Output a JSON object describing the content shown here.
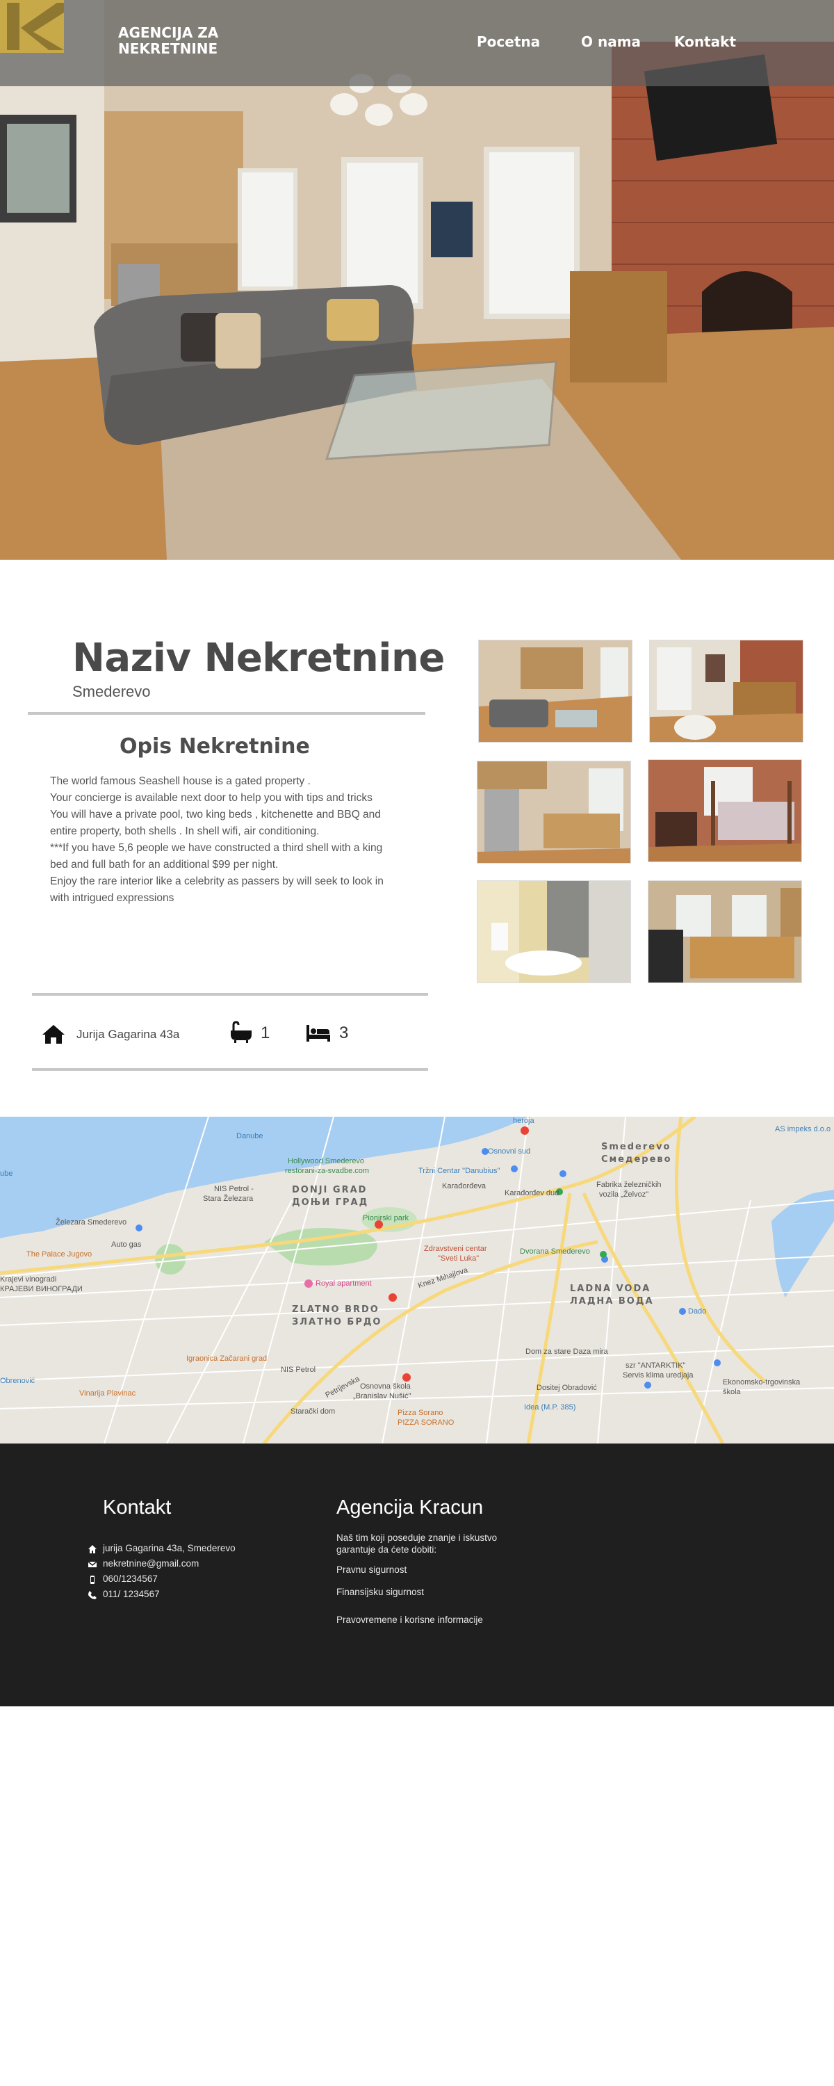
{
  "header": {
    "brand_line1": "AGENCIJA ZA",
    "brand_line2": "NEKRETNINE",
    "logo_letter": "K",
    "nav": [
      "Pocetna",
      "O nama",
      "Kontakt"
    ]
  },
  "property": {
    "title": "Naziv Nekretnine",
    "city": "Smederevo",
    "description_title": "Opis Nekretnine",
    "description_lines": [
      "The world famous Seashell house is a gated property .",
      "Your concierge is available next door to help you with tips and tricks",
      "You will have a private pool, two king beds , kitchenette and BBQ and",
      "entire property, both shells . In shell wifi, air conditioning.",
      "***If you have 5,6 people we have constructed a third shell with a king",
      "bed and full bath for an additional $99 per night.",
      "Enjoy the rare interior like a celebrity as passers by will seek to look in",
      "with intrigued expressions"
    ],
    "address": "Jurija Gagarina 43a",
    "bathrooms": "1",
    "beds": "3",
    "icons": {
      "address": "home-icon",
      "bath": "bathtub-icon",
      "bed": "bed-icon"
    }
  },
  "map": {
    "labels": {
      "danube": "Danube",
      "smederevo_lat": "Smederevo",
      "smederevo_cyr": "Смедерево",
      "hollywood": "Hollywood Smederevo",
      "hollywood2": "restorani-za-svadbe.com",
      "nis_petrol": "NIS Petrol -",
      "stara": "Stara Železara",
      "trzni": "Tržni Centar \"Danubius\"",
      "karadjordjeva": "Karađorđeva",
      "karadjordjev_dud": "Karađorđev dud",
      "donji_grad": "DONJI GRAD",
      "donji_grad_cyr": "ДОЊИ ГРАД",
      "fabrika": "Fabrika železničkih",
      "fabrika2": "vozila „Želvoz\"",
      "zelezara": "Železara Smederevo",
      "auto_gas": "Auto gas",
      "pionirski": "Pionirski park",
      "palace": "The Palace Jugovo",
      "krajevi": "Krajevi vinogradi",
      "krajevi2": "КРАЈЕВИ ВИНОГРАДИ",
      "zdravstveni": "Zdravstveni centar",
      "sveti_luka": "\"Sveti Luka\"",
      "dvorana": "Dvorana Smederevo",
      "royal": "Royal apartment",
      "knez": "Knez Mihajlova",
      "zlatno": "ZLATNO BRDO",
      "zlatno_cyr": "ЗЛАТНО БРДО",
      "ladna": "LADNA VODA",
      "ladna_cyr": "ЛАДНА ВОДА",
      "igraonica": "Igraonica Začarani grad",
      "nis2": "NIS Petrol",
      "osnovna": "Osnovna škola",
      "nusic": "„Branislav Nušić\"",
      "dom": "Dom za stare Dazа mira",
      "antarktik": "szr \"ANTARKTIK\"",
      "klima": "Servis klima uredjaja",
      "dositej": "Dositej Obradović",
      "ekonomsko": "Ekonomsko-trgovinska",
      "skola": "škola",
      "dado": "Dado",
      "idea": "Idea (M.P. 385)",
      "staracki": "Starački dom",
      "pizza": "Pizza Sorano",
      "pizza2": "PIZZA SORANO",
      "vinarija": "Vinarija Plavinac",
      "obrenovic": "Obrenović",
      "as_impeks": "AS impeks d.o.o",
      "osnovni_sud": "Osnovni sud",
      "petrijevska": "Petrijevska",
      "bube": "ube",
      "heroja": "heroja"
    }
  },
  "footer": {
    "contact_title": "Kontakt",
    "contact_lines": [
      "jurija Gagarina 43a,  Smederevo",
      "nekretnine@gmail.com",
      "060/1234567",
      "011/ 1234567"
    ],
    "contact_icons": [
      "home-icon",
      "envelope-icon",
      "mobile-phone-icon",
      "phone-icon"
    ],
    "agency_title": "Agencija Kracun",
    "agency_intro_1": "Naš tim koji poseduje znanje i iskustvo",
    "agency_intro_2": "garantuje da ćete dobiti:",
    "agency_items": [
      "Pravnu sigurnost",
      "Finansijsku sigurnost",
      "Pravovremene i korisne informacije"
    ]
  },
  "colors": {
    "nav_overlay": "#5f5f5f",
    "logo_gold": "#c7a94a",
    "rule_gray": "#c7c7c7",
    "footer_bg": "#1f1f1f"
  }
}
